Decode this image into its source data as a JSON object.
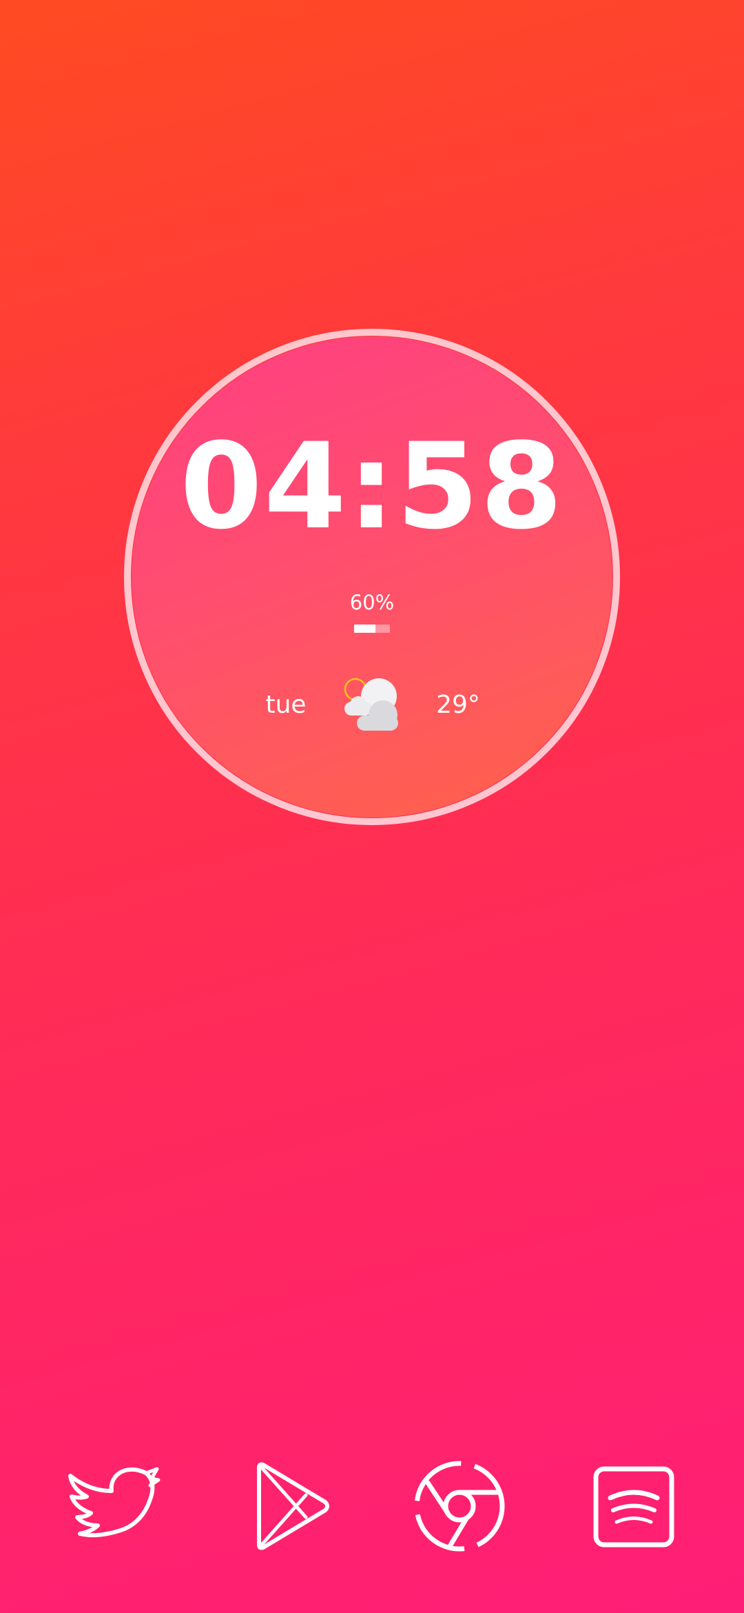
{
  "clock": {
    "time": "04:58",
    "seconds_progress": 0.97
  },
  "battery": {
    "label": "60%",
    "level": 0.6
  },
  "weather": {
    "day": "tue",
    "temperature": "29°",
    "condition_icon": "partly-cloudy-icon"
  },
  "dock": {
    "apps": [
      {
        "icon": "twitter-icon"
      },
      {
        "icon": "play-store-icon"
      },
      {
        "icon": "chrome-icon"
      },
      {
        "icon": "spotify-icon"
      }
    ]
  },
  "colors": {
    "background_top": "#ff4b22",
    "background_bottom": "#ff1e77",
    "face_top": "#ff3f82",
    "face_bottom": "#ff6044",
    "ring_track": "#ffe0e6",
    "ring_progress": "#ff2d8a",
    "sun": "#f5c518",
    "text": "#ffffff"
  }
}
